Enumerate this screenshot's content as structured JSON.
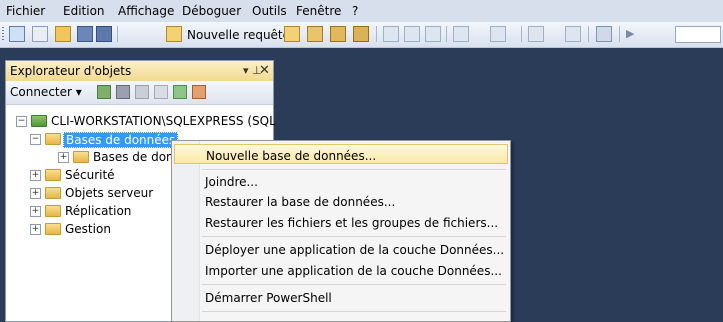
{
  "menubar": {
    "items": [
      "Fichier",
      "Edition",
      "Affichage",
      "Déboguer",
      "Outils",
      "Fenêtre",
      "?"
    ]
  },
  "toolbar": {
    "new_query_label": "Nouvelle requête"
  },
  "object_explorer": {
    "title": "Explorateur d'objets",
    "pin_glyph": "▾ ⊥",
    "close_glyph": "✕",
    "connect_label": "Connecter ▾",
    "tree": [
      {
        "label": "CLI-WORKSTATION\\SQLEXPRESS (SQL",
        "expander": "−"
      },
      {
        "label": "Bases de données",
        "expander": "−",
        "selected": true
      },
      {
        "label": "Bases de don",
        "expander": "+"
      },
      {
        "label": "Sécurité",
        "expander": "+"
      },
      {
        "label": "Objets serveur",
        "expander": "+"
      },
      {
        "label": "Réplication",
        "expander": "+"
      },
      {
        "label": "Gestion",
        "expander": "+"
      }
    ]
  },
  "context_menu": {
    "items": [
      {
        "label": "Nouvelle base de données...",
        "highlighted": true
      },
      {
        "label": "Joindre..."
      },
      {
        "label": "Restaurer la base de données..."
      },
      {
        "label": "Restaurer les fichiers et les groupes de fichiers..."
      },
      {
        "label": "Déployer une application de la couche Données..."
      },
      {
        "label": "Importer une application de la couche Données..."
      },
      {
        "label": "Démarrer PowerShell"
      }
    ]
  },
  "colors": {
    "background": "#2b3c59",
    "selection": "#3399ff",
    "panel_header": "#f2d98f",
    "menu_highlight": "#fbe9a6"
  }
}
